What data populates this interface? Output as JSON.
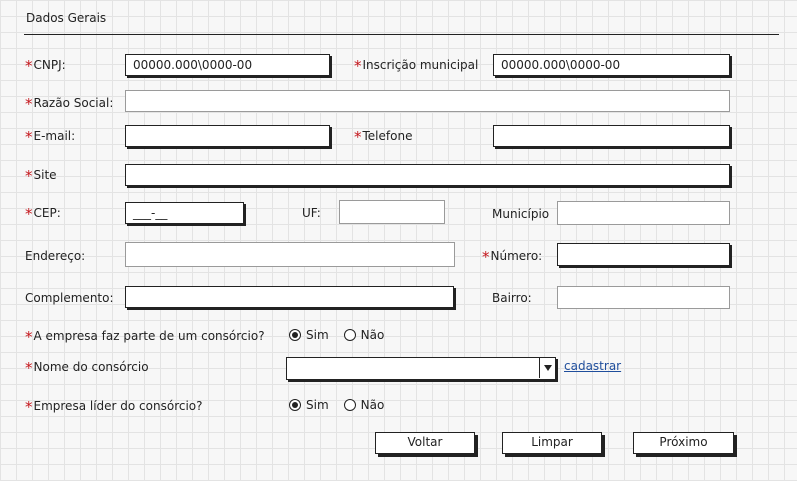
{
  "section_title": "Dados Gerais",
  "required_marker": "*",
  "fields": {
    "cnpj": {
      "label": "CNPJ:",
      "value": "00000.000\\0000-00"
    },
    "inscricao_municipal": {
      "label": "Inscrição municipal",
      "value": "00000.000\\0000-00"
    },
    "razao_social": {
      "label": "Razão Social:",
      "value": ""
    },
    "email": {
      "label": "E-mail:",
      "value": ""
    },
    "telefone": {
      "label": "Telefone",
      "value": ""
    },
    "site": {
      "label": "Site",
      "value": ""
    },
    "cep": {
      "label": "CEP:",
      "value": "___-__"
    },
    "uf": {
      "label": "UF:",
      "value": ""
    },
    "municipio": {
      "label": "Município",
      "value": ""
    },
    "endereco": {
      "label": "Endereço:",
      "value": ""
    },
    "numero": {
      "label": "Número:",
      "value": ""
    },
    "complemento": {
      "label": "Complemento:",
      "value": ""
    },
    "bairro": {
      "label": "Bairro:",
      "value": ""
    }
  },
  "consorcio": {
    "question": "A empresa faz parte de um consórcio?",
    "options": [
      "Sim",
      "Não"
    ],
    "selected": "Sim",
    "name_label": "Nome do consórcio",
    "name_value": "",
    "cadastrar_link": "cadastrar",
    "lider_question": "Empresa líder do consórcio?",
    "lider_options": [
      "Sim",
      "Não"
    ],
    "lider_selected": "Sim"
  },
  "buttons": {
    "back": "Voltar",
    "clear": "Limpar",
    "next": "Próximo"
  },
  "colors": {
    "required": "#c4161c",
    "link": "#1f4e9c"
  }
}
